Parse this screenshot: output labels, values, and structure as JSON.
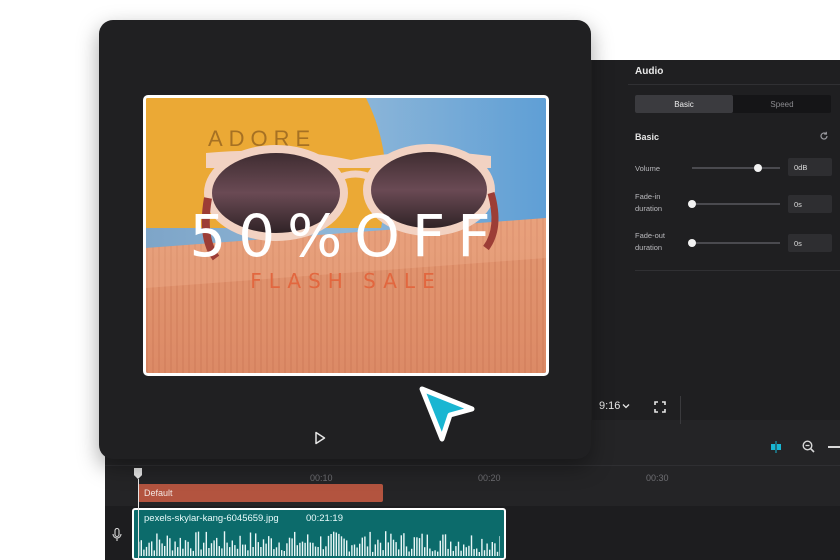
{
  "properties_panel": {
    "title": "Audio",
    "tabs": [
      {
        "label": "Basic",
        "active": true
      },
      {
        "label": "Speed",
        "active": false
      }
    ],
    "section": "Basic",
    "rows": [
      {
        "label_lines": [
          "Volume"
        ],
        "value": "0dB",
        "level": 0.75
      },
      {
        "label_lines": [
          "Fade-in",
          "duration"
        ],
        "value": "0s",
        "level": 0.0
      },
      {
        "label_lines": [
          "Fade-out",
          "duration"
        ],
        "value": "0s",
        "level": 0.0
      }
    ]
  },
  "preview_controls": {
    "aspect_ratio": "9:16",
    "icons": [
      "chevron-down-icon",
      "fullscreen-icon",
      "play-icon"
    ]
  },
  "preview_image": {
    "headline": "50%OFF",
    "subline": "FLASH SALE",
    "case_text": "ADORE"
  },
  "timeline": {
    "ruler_ticks": [
      "00:10",
      "00:20",
      "00:30"
    ],
    "text_clip": "Default",
    "audio_clip": {
      "name": "pexels-skylar-kang-6045659.jpg",
      "duration": "00:21:19"
    },
    "icons": [
      "split-icon",
      "zoom-out-icon",
      "mic-icon"
    ]
  },
  "colors": {
    "accent_cyan": "#19b6d2",
    "audio_clip": "#0c6b6b",
    "text_clip": "#b3543f",
    "sale_orange": "#e2673f"
  }
}
